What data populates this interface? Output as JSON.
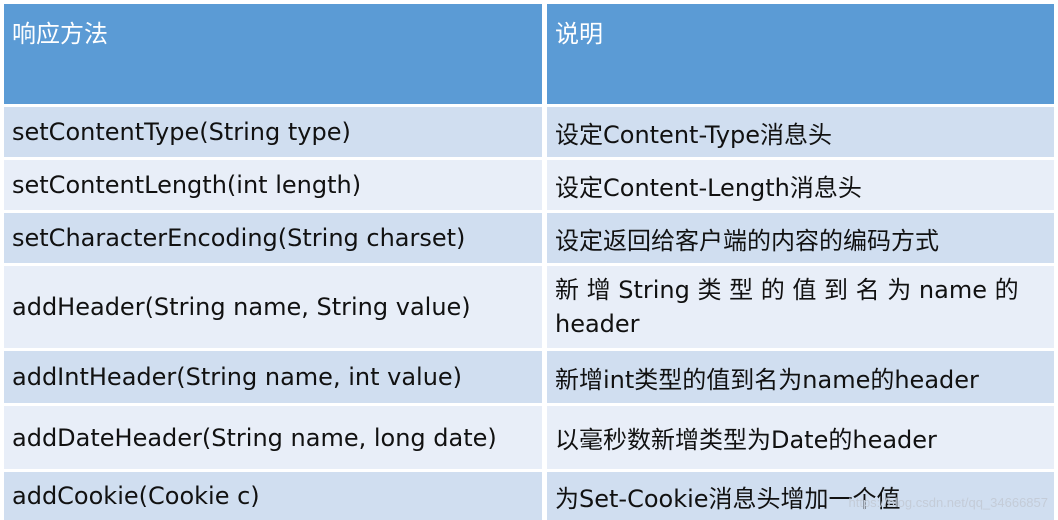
{
  "table": {
    "headers": [
      "响应方法",
      "说明"
    ],
    "rows": [
      {
        "method": "setContentType(String type)",
        "description": "设定Content-Type消息头"
      },
      {
        "method": "setContentLength(int length)",
        "description": "设定Content-Length消息头"
      },
      {
        "method": "setCharacterEncoding(String charset)",
        "description": "设定返回给客户端的内容的编码方式"
      },
      {
        "method": "addHeader(String name, String value)",
        "description": "新 增 String 类 型 的 值 到 名 为 name 的 header"
      },
      {
        "method": "addIntHeader(String name, int value)",
        "description": "新增int类型的值到名为name的header"
      },
      {
        "method": "addDateHeader(String name, long date)",
        "description": "以毫秒数新增类型为Date的header"
      },
      {
        "method": "addCookie(Cookie c)",
        "description": "为Set-Cookie消息头增加一个值"
      }
    ]
  },
  "watermark": "https://blog.csdn.net/qq_34666857",
  "colors": {
    "header_bg": "#5b9bd5",
    "row_odd_bg": "#d0def0",
    "row_even_bg": "#e8eef8",
    "header_text": "#ffffff",
    "body_text": "#111111"
  }
}
